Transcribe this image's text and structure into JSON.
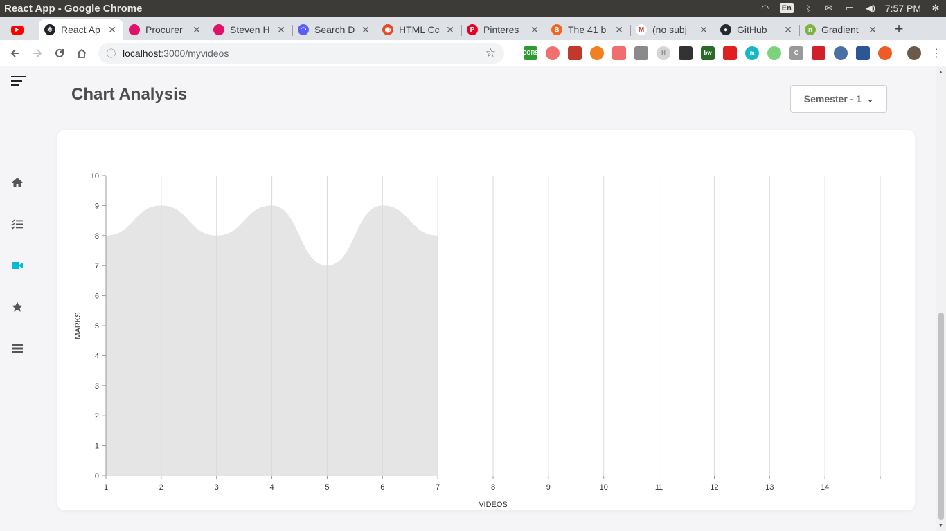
{
  "window": {
    "title": "React App - Google Chrome",
    "tray": {
      "lang": "En",
      "time": "7:57 PM"
    }
  },
  "tabs": [
    {
      "title": "",
      "favicon": "youtube-icon",
      "color": "#ff0000",
      "glyph": "▶"
    },
    {
      "title": "React Ap",
      "favicon": "react-icon",
      "color": "#20232a",
      "glyph": "⚛",
      "active": true
    },
    {
      "title": "Procurer",
      "favicon": "dribbble-icon",
      "color": "#e0106b",
      "glyph": ""
    },
    {
      "title": "Steven H",
      "favicon": "dribbble-icon",
      "color": "#e0106b",
      "glyph": ""
    },
    {
      "title": "Search D",
      "favicon": "loading-icon",
      "color": "#5b5ff2",
      "glyph": "◠"
    },
    {
      "title": "HTML Cc",
      "favicon": "html-icon",
      "color": "#e34c26",
      "glyph": "◉"
    },
    {
      "title": "Pinteres",
      "favicon": "pinterest-icon",
      "color": "#e60023",
      "glyph": "P"
    },
    {
      "title": "The 41 b",
      "favicon": "site-icon",
      "color": "#f26522",
      "glyph": "B"
    },
    {
      "title": "(no subj",
      "favicon": "gmail-icon",
      "color": "#ffffff",
      "glyph": "M"
    },
    {
      "title": "GitHub",
      "favicon": "github-icon",
      "color": "#24292e",
      "glyph": "●"
    },
    {
      "title": "Gradient",
      "favicon": "gradient-icon",
      "color": "#7cb342",
      "glyph": "n"
    }
  ],
  "address": {
    "host": "localhost",
    "path": ":3000/myvideos"
  },
  "extensions": [
    {
      "name": "cors-extension-icon",
      "color": "#2e9b2e",
      "label": "CORS"
    },
    {
      "name": "ext-icon-2",
      "color": "#f07070",
      "label": ""
    },
    {
      "name": "ext-icon-3",
      "color": "#c0392b",
      "label": ""
    },
    {
      "name": "ext-icon-4",
      "color": "#f08020",
      "label": ""
    },
    {
      "name": "ext-icon-5",
      "color": "#f06e6e",
      "label": ""
    },
    {
      "name": "ext-icon-6",
      "color": "#8a8a8a",
      "label": ""
    },
    {
      "name": "ext-icon-7",
      "color": "#d5d5d5",
      "label": "H"
    },
    {
      "name": "ext-icon-8",
      "color": "#333333",
      "label": ""
    },
    {
      "name": "ext-icon-9",
      "color": "#2a6b2a",
      "label": "bw"
    },
    {
      "name": "ext-icon-10",
      "color": "#e02020",
      "label": ""
    },
    {
      "name": "ext-icon-11",
      "color": "#14b8c4",
      "label": "m"
    },
    {
      "name": "ext-icon-12",
      "color": "#7bd47b",
      "label": ""
    },
    {
      "name": "ext-icon-13",
      "color": "#9a9a9a",
      "label": "G"
    },
    {
      "name": "ext-icon-14",
      "color": "#d0202a",
      "label": ""
    },
    {
      "name": "ext-icon-15",
      "color": "#4a6fa5",
      "label": ""
    },
    {
      "name": "ext-icon-16",
      "color": "#2b5797",
      "label": ""
    },
    {
      "name": "ext-icon-17",
      "color": "#ef5b25",
      "label": ""
    }
  ],
  "sidebar": {
    "items": [
      {
        "name": "home-icon",
        "active": false
      },
      {
        "name": "tasks-list-icon",
        "active": false
      },
      {
        "name": "video-icon",
        "active": true
      },
      {
        "name": "star-icon",
        "active": false
      },
      {
        "name": "table-list-icon",
        "active": false
      }
    ],
    "active_color": "#00bcd4",
    "icon_color": "#555555"
  },
  "main": {
    "title": "Chart Analysis",
    "semester_label": "Semester - 1"
  },
  "chart_data": {
    "type": "area",
    "xlabel": "VIDEOS",
    "ylabel": "MARKS",
    "x_ticks": [
      1,
      2,
      3,
      4,
      5,
      6,
      7,
      8,
      9,
      10,
      11,
      12,
      13,
      14
    ],
    "xlim": [
      1,
      15
    ],
    "ylim": [
      0,
      10
    ],
    "y_ticks": [
      0,
      1,
      2,
      3,
      4,
      5,
      6,
      7,
      8,
      9,
      10
    ],
    "series": [
      {
        "x": [
          1,
          2,
          3,
          4,
          5,
          6,
          7
        ],
        "values": [
          8,
          9,
          8,
          9,
          7,
          9,
          8
        ]
      }
    ],
    "fill_color": "#e5e5e5",
    "grid": "vertical"
  }
}
